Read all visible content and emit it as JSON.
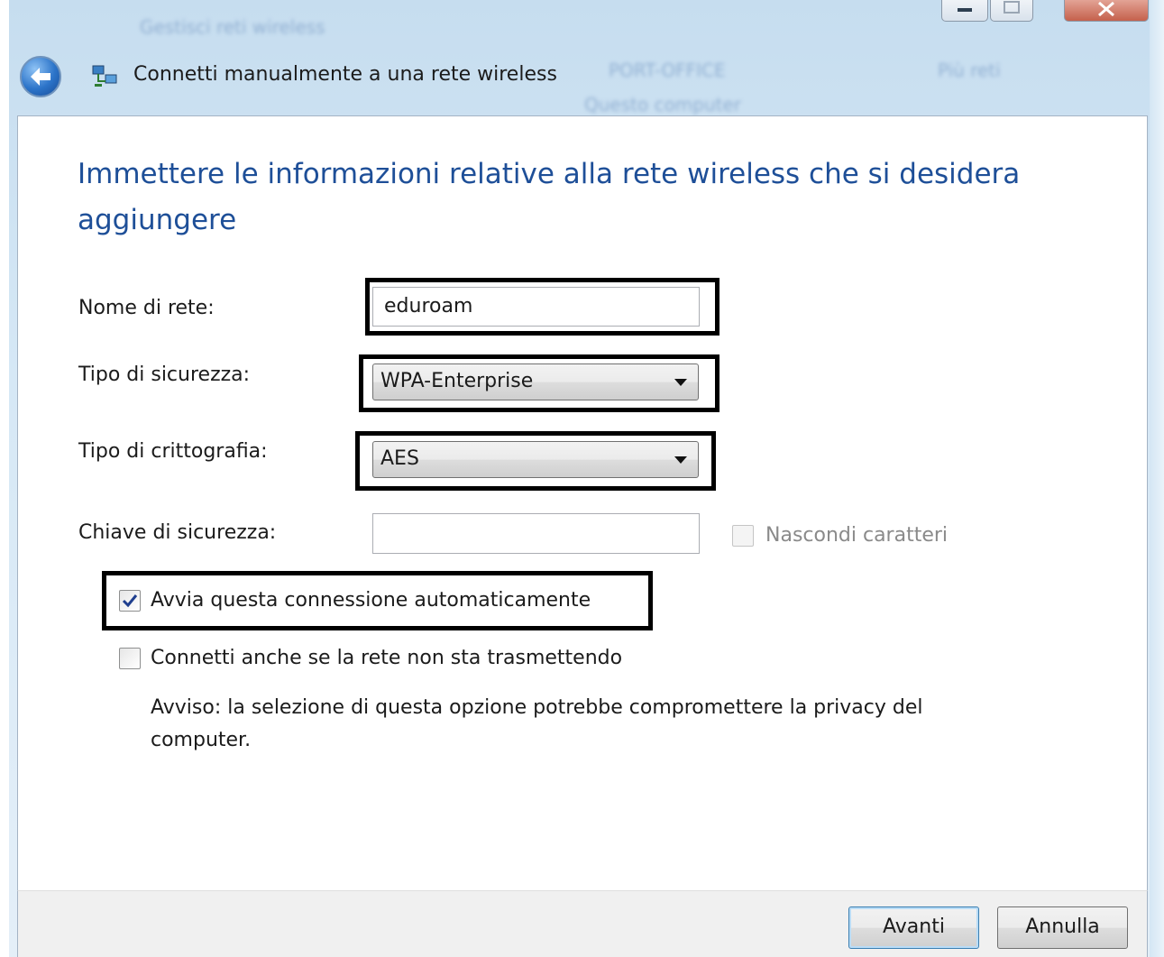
{
  "window": {
    "title": "Connetti manualmente a una rete wireless"
  },
  "icons": {
    "back": "back-arrow-icon",
    "network": "network-computers-icon",
    "minimize": "minimize-icon",
    "maximize": "maximize-icon",
    "close": "close-icon",
    "dropdown": "chevron-down-icon",
    "check": "checkmark-icon"
  },
  "background_blur": {
    "top_left": "Gestisci reti wireless",
    "center_top": "PORT-OFFICE",
    "center_sub": "Questo computer",
    "right": "Più reti"
  },
  "heading": "Immettere le informazioni relative alla rete wireless che si desidera aggiungere",
  "form": {
    "network_name": {
      "label": "Nome di rete:",
      "value": "eduroam"
    },
    "security_type": {
      "label": "Tipo di sicurezza:",
      "value": "WPA-Enterprise"
    },
    "encryption_type": {
      "label": "Tipo di crittografia:",
      "value": "AES"
    },
    "security_key": {
      "label": "Chiave di sicurezza:",
      "value": ""
    },
    "hide_chars": {
      "label": "Nascondi caratteri",
      "checked": false,
      "enabled": false
    },
    "auto_start": {
      "label": "Avvia questa connessione automaticamente",
      "checked": true
    },
    "connect_hidden": {
      "label": "Connetti anche se la rete non sta trasmettendo",
      "checked": false
    },
    "warning": "Avviso: la selezione di questa opzione potrebbe compromettere la privacy del computer."
  },
  "buttons": {
    "next": "Avanti",
    "cancel": "Annulla"
  },
  "colors": {
    "heading": "#1e4f98",
    "highlight_border": "#000000",
    "footer": "#f0f0f0"
  }
}
